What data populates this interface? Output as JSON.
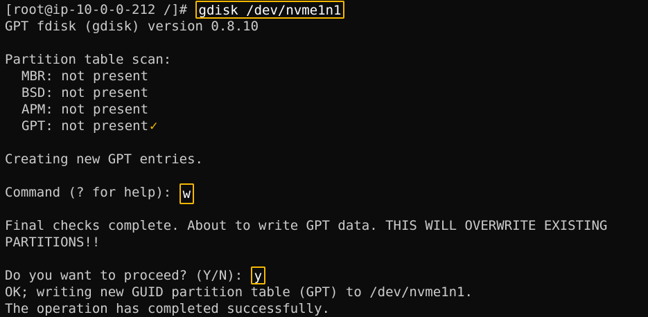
{
  "terminal": {
    "prompt": "[root@ip-10-0-0-212 /]# ",
    "command": "gdisk /dev/nvme1n1",
    "version_line": "GPT fdisk (gdisk) version 0.8.10",
    "scan_header": "Partition table scan:",
    "scan": [
      "MBR: not present",
      "BSD: not present",
      "APM: not present",
      "GPT: not present"
    ],
    "check_mark": "✓",
    "creating": "Creating new GPT entries.",
    "cmd_prompt": "Command (? for help): ",
    "cmd_input": "w",
    "final_check_1": "Final checks complete. About to write GPT data. THIS WILL OVERWRITE EXISTING",
    "final_check_2": "PARTITIONS!!",
    "proceed_prompt": "Do you want to proceed? (Y/N): ",
    "proceed_input": "y",
    "ok_line": "OK; writing new GUID partition table (GPT) to /dev/nvme1n1.",
    "done_line": "The operation has completed successfully."
  },
  "colors": {
    "background": "#0c0c0c",
    "text": "#cccccc",
    "highlight": "#f5b800"
  }
}
